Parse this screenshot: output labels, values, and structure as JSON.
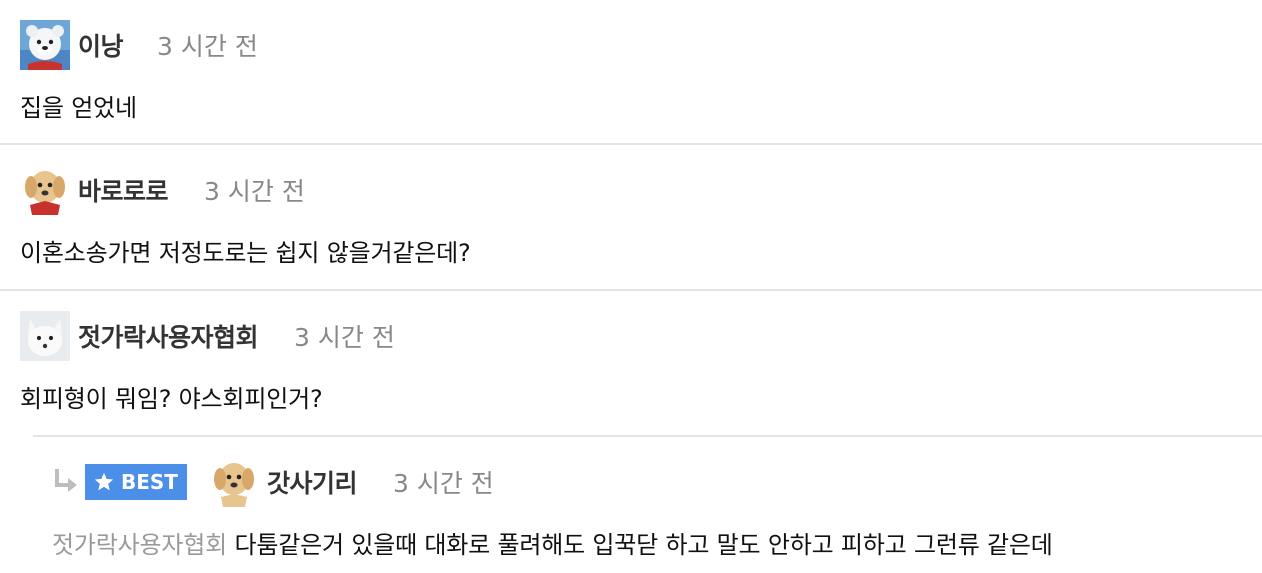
{
  "comments": [
    {
      "avatar": "polar-bear-avatar",
      "nickname": "이낭",
      "time": "3 시간 전",
      "text": "집을 얻었네"
    },
    {
      "avatar": "puppy-avatar",
      "nickname": "바로로로",
      "time": "3 시간 전",
      "text": "이혼소송가면 저정도로는 쉽지 않을거같은데?"
    },
    {
      "avatar": "arctic-fox-avatar",
      "nickname": "젓가락사용자협회",
      "time": "3 시간 전",
      "text": "회피형이 뭐임? 야스회피인거?"
    }
  ],
  "reply": {
    "badge": "BEST",
    "avatar": "puppy-avatar",
    "nickname": "갓사기리",
    "time": "3 시간 전",
    "mention": "젓가락사용자협회",
    "text": "다툼같은거 있을때 대화로 풀려해도 입꾹닫 하고 말도 안하고 피하고 그런류 같은데"
  },
  "colors": {
    "badge_bg": "#4b8fe8",
    "divider": "#e4e4e4",
    "time_text": "#888888",
    "mention_text": "#9a9a9a"
  },
  "icons": [
    "reply-arrow-icon",
    "star-icon"
  ]
}
